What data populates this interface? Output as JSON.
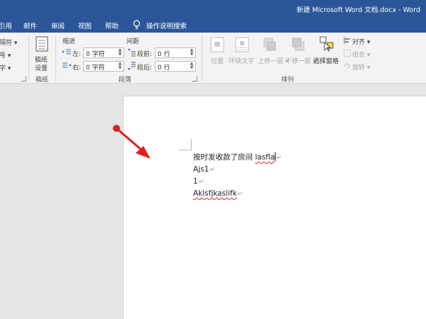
{
  "window": {
    "title": "新建 Microsoft Word 文档.docx  -  Word"
  },
  "tabs": [
    "引用",
    "邮件",
    "审阅",
    "视图",
    "帮助"
  ],
  "tell_me": {
    "label": "操作说明搜索",
    "icon": "lightbulb-icon"
  },
  "ribbon": {
    "partial_left": {
      "item1": "隔符",
      "item2": "号",
      "item3": "字"
    },
    "manuscript": {
      "button_line1": "稿纸",
      "button_line2": "设置",
      "group_label": "稿纸"
    },
    "paragraph": {
      "indent_header": "缩进",
      "spacing_header": "间距",
      "left_label": "左:",
      "left_value": "0 字符",
      "right_label": "右:",
      "right_value": "0 字符",
      "before_label": "段前:",
      "before_value": "0 行",
      "after_label": "段后:",
      "after_value": "0 行",
      "group_label": "段落"
    },
    "arrange": {
      "position": "位置",
      "wrap_text": "环绕文字",
      "bring_forward": "上移一层",
      "send_backward": "下移一层",
      "selection_pane": "选择窗格",
      "align": "对齐",
      "group": "组合",
      "rotate": "旋转",
      "group_label": "排列"
    }
  },
  "document": {
    "lines": [
      {
        "prefix": "按时发收款了房间 ",
        "squiggle": "lasfla"
      },
      {
        "prefix": "Ajs1",
        "squiggle": ""
      },
      {
        "prefix": "1",
        "squiggle": ""
      },
      {
        "prefix": "",
        "squiggle": "Aklsfjkaslifk"
      }
    ],
    "para_mark": "↵"
  },
  "colors": {
    "accent": "#2b579a",
    "arrow": "#e0201c",
    "squiggle": "#e02020"
  }
}
